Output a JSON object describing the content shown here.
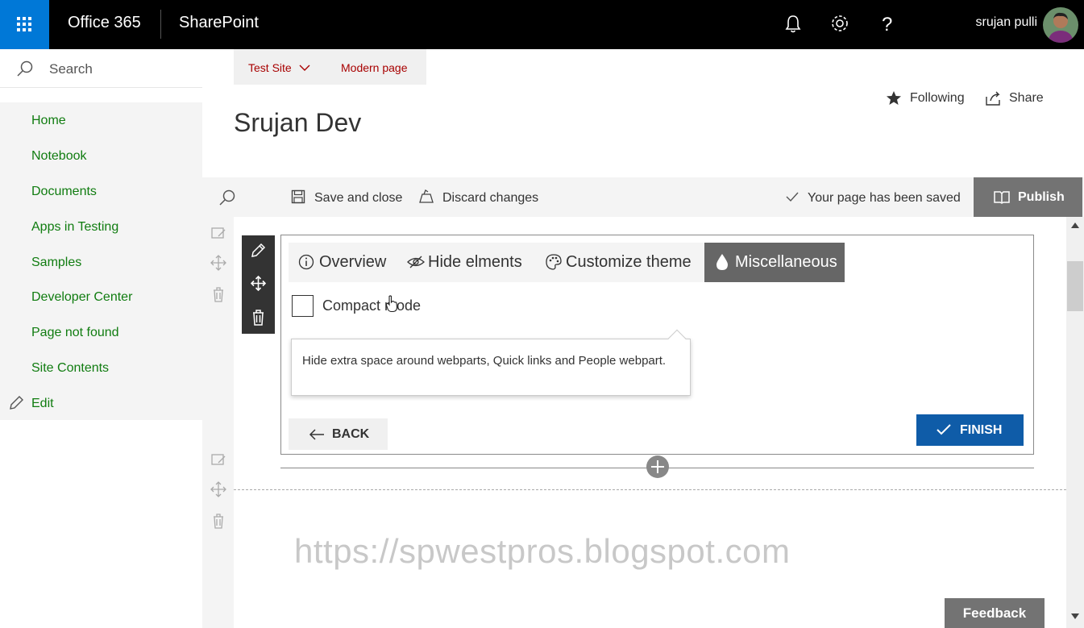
{
  "suite": {
    "product": "Office 365",
    "app": "SharePoint",
    "user_name": "srujan pulli",
    "accent": "#0078d7"
  },
  "search": {
    "placeholder": "Search"
  },
  "nav": {
    "items": [
      {
        "label": "Home"
      },
      {
        "label": "Notebook"
      },
      {
        "label": "Documents"
      },
      {
        "label": "Apps in Testing"
      },
      {
        "label": "Samples"
      },
      {
        "label": "Developer Center"
      },
      {
        "label": "Page not found"
      },
      {
        "label": "Site Contents"
      }
    ],
    "edit_label": "Edit",
    "link_color": "#107c10"
  },
  "sitebar": {
    "site": "Test Site",
    "page": "Modern page"
  },
  "header": {
    "title": "Srujan Dev",
    "following_label": "Following",
    "share_label": "Share"
  },
  "commandbar": {
    "save_label": "Save and close",
    "discard_label": "Discard changes",
    "status": "Your page has been saved",
    "publish_label": "Publish"
  },
  "panel": {
    "tabs": [
      {
        "label": "Overview",
        "icon": "info-icon"
      },
      {
        "label": "Hide elments",
        "icon": "hide-eye-icon"
      },
      {
        "label": "Customize theme",
        "icon": "palette-icon"
      },
      {
        "label": "Miscellaneous",
        "icon": "drop-icon",
        "active": true
      }
    ],
    "checkbox_label": "Compact mode",
    "tooltip": "Hide extra space around webparts, Quick links and People webpart.",
    "back_label": "BACK",
    "finish_label": "FINISH",
    "finish_color": "#0f5ca8"
  },
  "watermark": "https://spwestpros.blogspot.com",
  "feedback_label": "Feedback"
}
